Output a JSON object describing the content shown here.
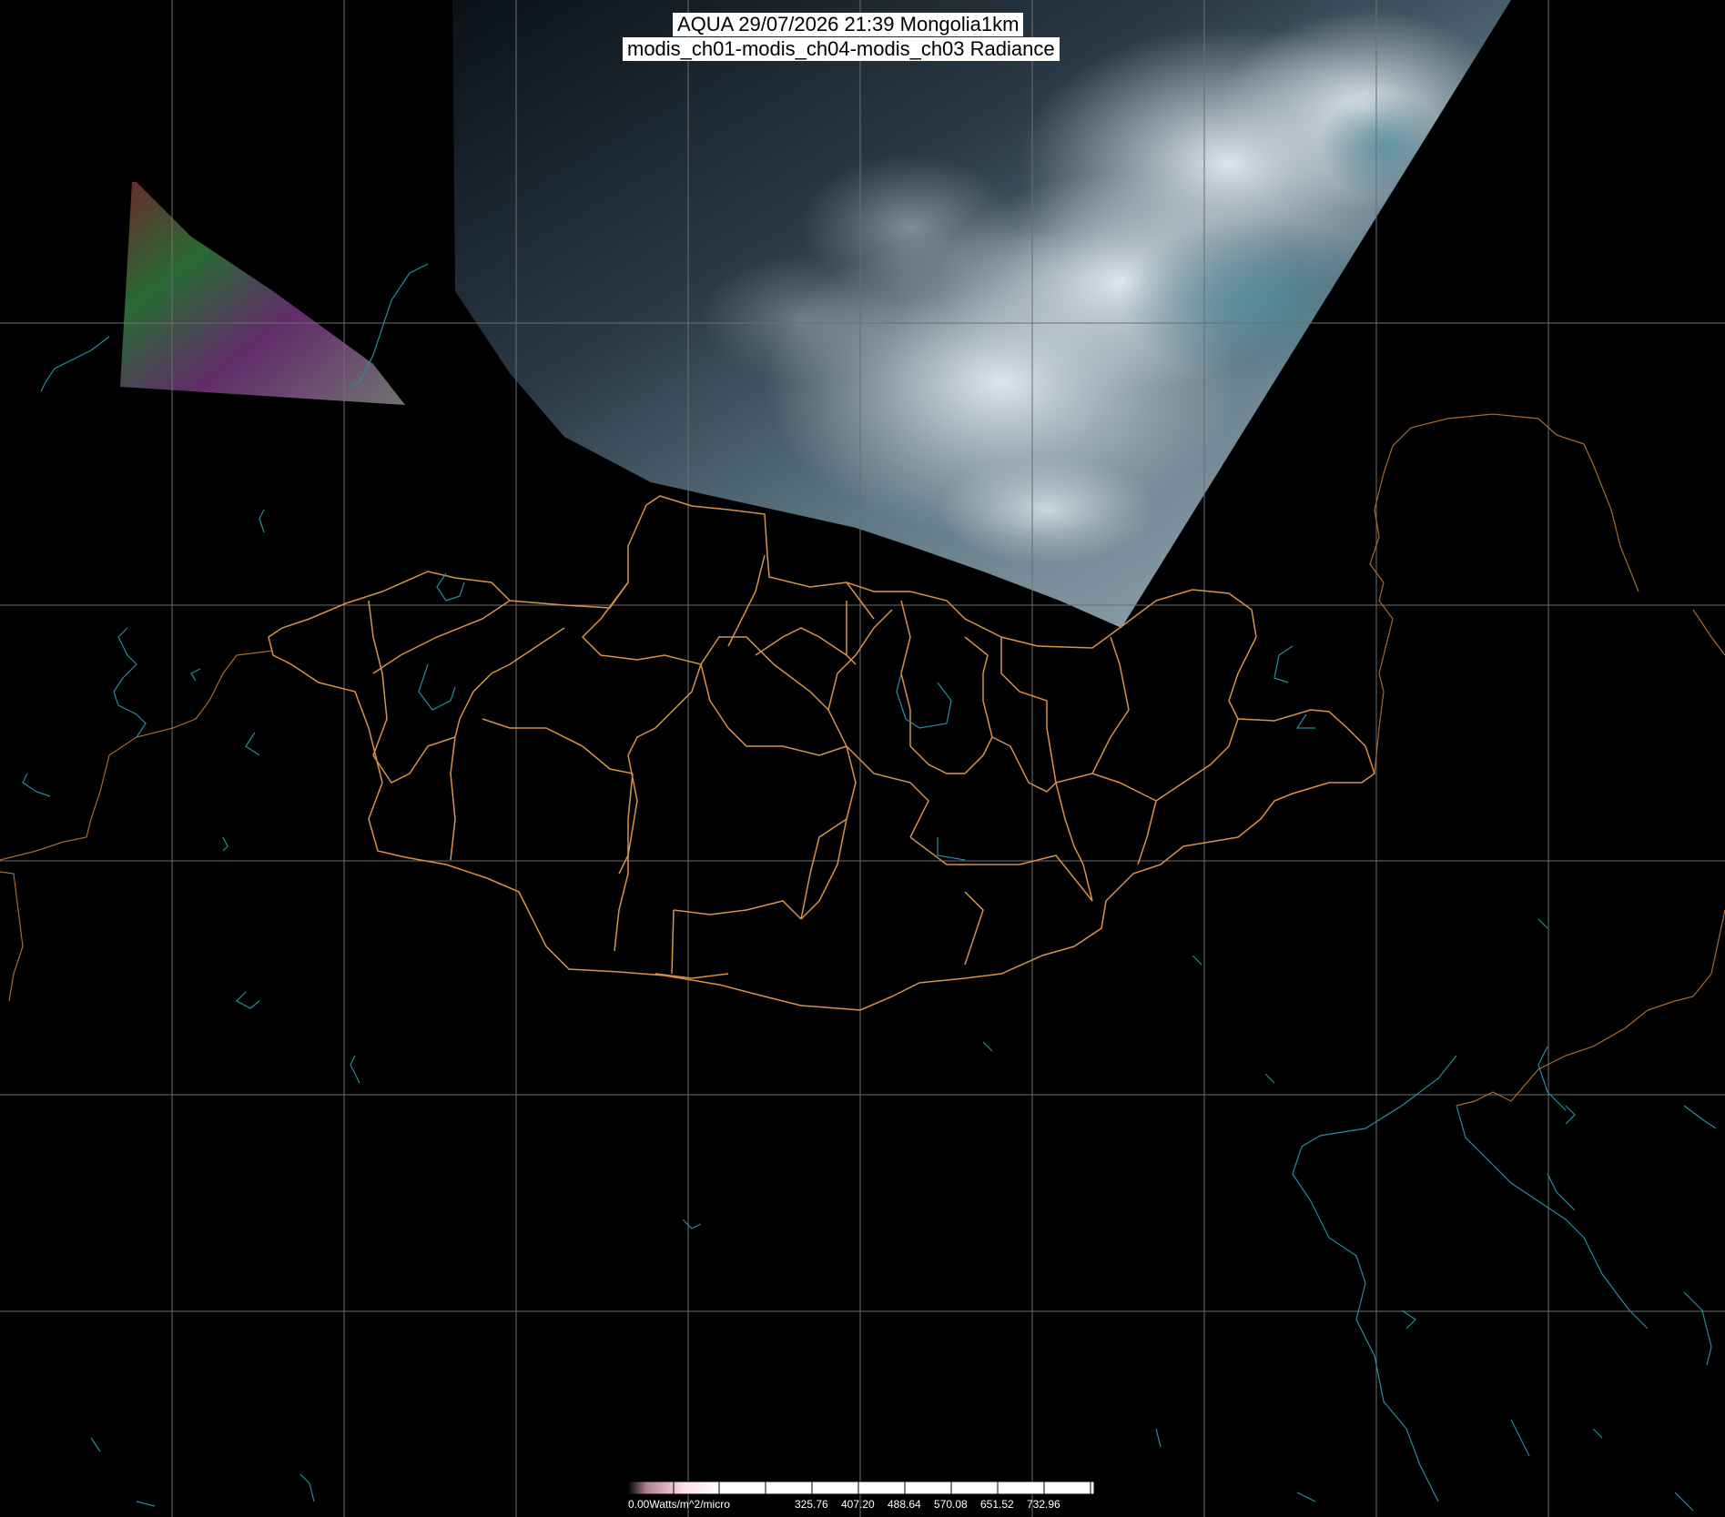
{
  "title": {
    "line1": "AQUA 29/07/2026 21:39 Mongolia1km",
    "line2": "modis_ch01-modis_ch04-modis_ch03 Radiance"
  },
  "colorbar": {
    "start_label": "0.00Watts/m^2/micro",
    "tick_labels": [
      "325.76",
      "407.20",
      "488.64",
      "570.08",
      "651.52",
      "732.96"
    ]
  },
  "colors": {
    "background": "#000000",
    "graticule": "#6e6e6e",
    "province_border": "#d8924a",
    "country_border": "#b9763a",
    "coastline_lakes": "#2a8aa0",
    "colorbar_fill": "#ffffff"
  },
  "layers": [
    "satellite-swath",
    "graticule",
    "province-borders",
    "coastlines-lakes",
    "colorbar"
  ]
}
